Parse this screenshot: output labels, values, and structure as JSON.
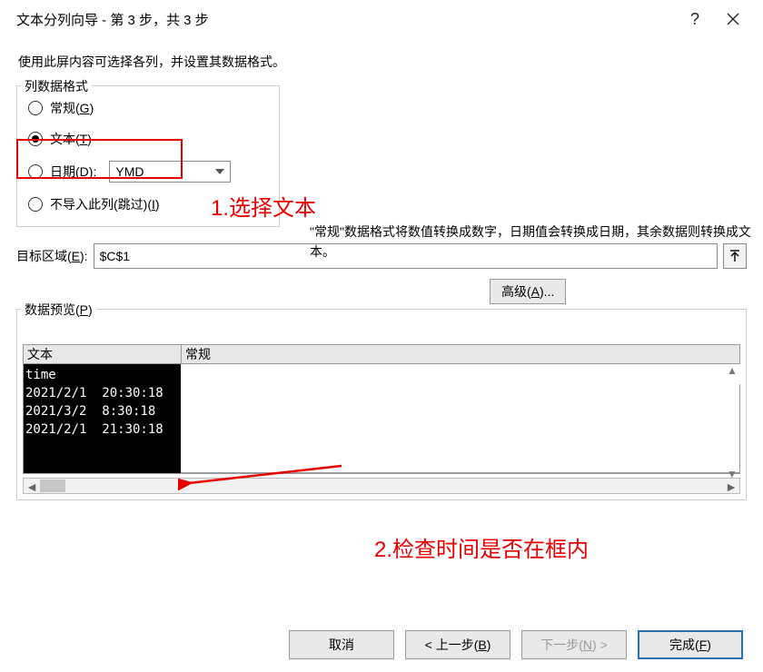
{
  "title": "文本分列向导 - 第 3 步，共 3 步",
  "intro": "使用此屏内容可选择各列，并设置其数据格式。",
  "fieldset_label": "列数据格式",
  "radios": {
    "general": "常规(G)",
    "text": "文本(T)",
    "date": "日期(D):",
    "skip": "不导入此列(跳过)(I)"
  },
  "date_format": "YMD",
  "description": "\"常规\"数据格式将数值转换成数字，日期值会转换成日期，其余数据则转换成文本。",
  "advanced": "高级(A)...",
  "dest_label": "目标区域(E):",
  "dest_value": "$C$1",
  "preview_label": "数据预览(P)",
  "preview_headers": {
    "c1": "文本",
    "c2": "常规"
  },
  "preview_rows": [
    "time",
    "2021/2/1  20:30:18",
    "2021/3/2  8:30:18",
    "2021/2/1  21:30:18"
  ],
  "annotations": {
    "a1": "1.选择文本",
    "a2": "2.检查时间是否在框内"
  },
  "buttons": {
    "cancel": "取消",
    "back": "< 上一步(B)",
    "next": "下一步(N) >",
    "finish": "完成(F)"
  },
  "colors": {
    "annotation": "#e60000",
    "primary": "#2a6fb5"
  }
}
